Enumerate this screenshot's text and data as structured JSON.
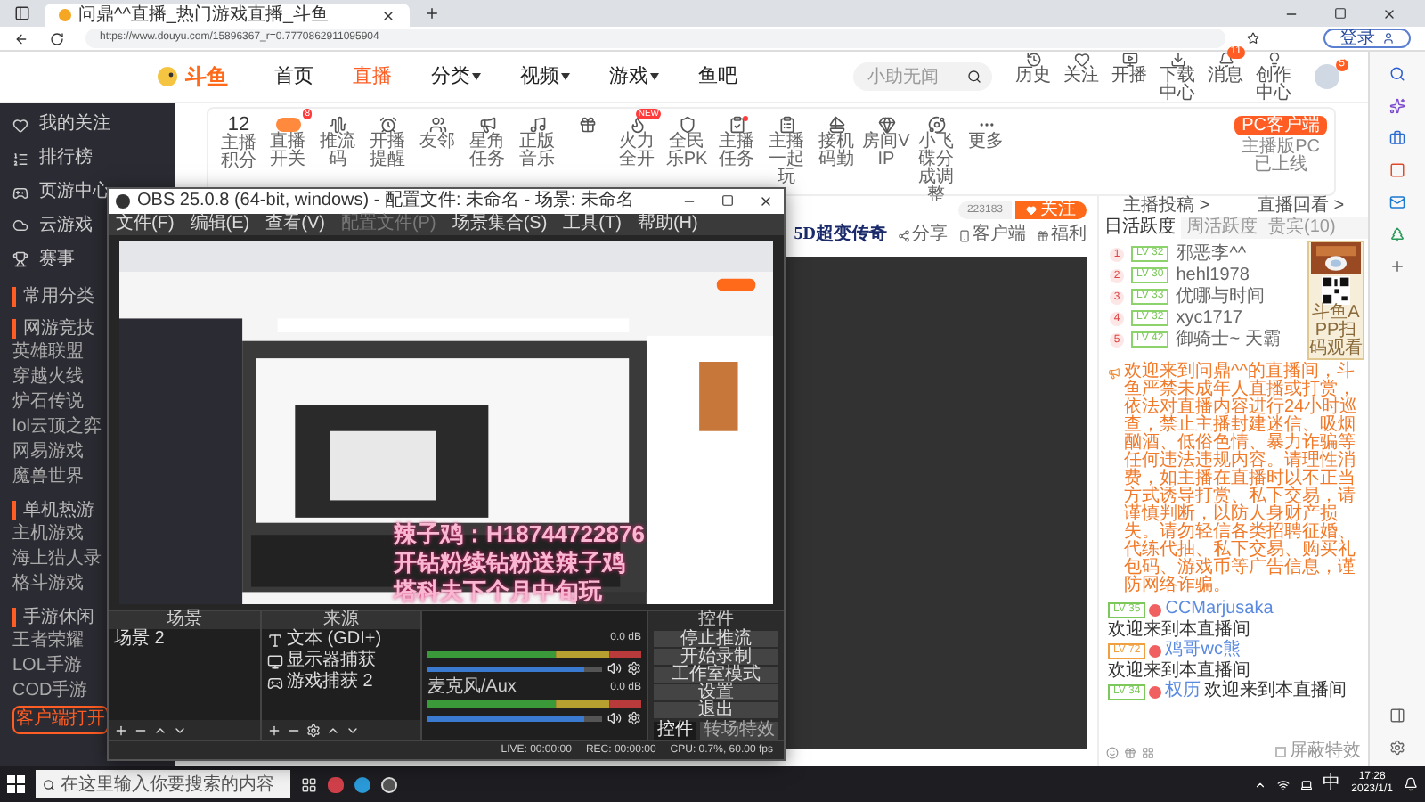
{
  "browser": {
    "tab_title": "问鼎^^直播_热门游戏直播_斗鱼",
    "url": "https://www.douyu.com/15896367_r=0.7770862911095904",
    "login": "登录"
  },
  "header": {
    "logo": "斗鱼",
    "nav": [
      {
        "label": "首页",
        "selected": false,
        "dropdown": false
      },
      {
        "label": "直播",
        "selected": true,
        "dropdown": false
      },
      {
        "label": "分类",
        "selected": false,
        "dropdown": true
      },
      {
        "label": "视频",
        "selected": false,
        "dropdown": true
      },
      {
        "label": "游戏",
        "selected": false,
        "dropdown": true
      },
      {
        "label": "鱼吧",
        "selected": false,
        "dropdown": false
      }
    ],
    "search": {
      "placeholder": "小助无闻"
    },
    "icons": [
      {
        "label": "历史"
      },
      {
        "label": "关注"
      },
      {
        "label": "开播"
      },
      {
        "label": "下载中心"
      },
      {
        "label": "消息",
        "badge": "11"
      },
      {
        "label": "创作中心"
      }
    ],
    "avatar_badge": "5"
  },
  "sidebar": {
    "items": [
      "我的关注",
      "排行榜",
      "页游中心",
      "云游戏",
      "赛事"
    ],
    "sections": [
      {
        "title": "常用分类"
      },
      {
        "title": "网游竞技",
        "items": [
          "英雄联盟",
          "穿越火线",
          "炉石传说",
          "lol云顶之弈",
          "网易游戏",
          "魔兽世界"
        ]
      },
      {
        "title": "单机热游",
        "items": [
          "主机游戏",
          "海上猎人录",
          "格斗游戏"
        ]
      },
      {
        "title": "手游休闲",
        "items": [
          "王者荣耀",
          "LOL手游",
          "COD手游"
        ]
      }
    ],
    "client_button": "客户端打开"
  },
  "toolbar": {
    "score": "12",
    "score_label": "主播积分",
    "items": [
      {
        "label": "直播开关",
        "badge": "8"
      },
      {
        "label": "推流码"
      },
      {
        "label": "开播提醒"
      },
      {
        "label": "友邻"
      },
      {
        "label": "星角任务"
      },
      {
        "label": "正版音乐"
      },
      {
        "label": "火力全开",
        "badge": "NEW"
      },
      {
        "label": "全民乐PK"
      },
      {
        "label": "主播任务",
        "dot": true
      },
      {
        "label": "主播一起玩"
      },
      {
        "label": "接机码勤"
      },
      {
        "label": "房间VIP"
      },
      {
        "label": "小飞碟分成调整"
      },
      {
        "label": "更多"
      }
    ],
    "pc_button": "PC客户端",
    "pc_note": "主播版PC已上线"
  },
  "room": {
    "followers": "223183",
    "follow": "关注",
    "logo": "5D超变传奇",
    "actions": [
      "分享",
      "客户端",
      "福利"
    ]
  },
  "chat": {
    "links": [
      "主播投稿 >",
      "直播回看 >"
    ],
    "tabs": [
      {
        "label": "日活跃度",
        "selected": true
      },
      {
        "label": "周活跃度",
        "selected": false
      },
      {
        "label": "贵宾(10)",
        "selected": false
      }
    ],
    "ranks": [
      {
        "rank": "1",
        "level": "LV 32",
        "name": "邪恶李^^"
      },
      {
        "rank": "2",
        "level": "LV 30",
        "name": "hehl1978"
      },
      {
        "rank": "3",
        "level": "LV 33",
        "name": "优哪与时间"
      },
      {
        "rank": "4",
        "level": "LV 32",
        "name": "xyc1717"
      },
      {
        "rank": "5",
        "level": "LV 42",
        "name": "御骑士~ 天霸"
      }
    ],
    "promo_caption": "斗鱼APP扫码观看",
    "notice": "欢迎来到问鼎^^的直播间，斗鱼严禁未成年人直播或打赏，依法对直播内容进行24小时巡查，禁止主播封建迷信、吸烟酗酒、低俗色情、暴力诈骗等任何违法违规内容。请理性消费，如主播在直播时以不正当方式诱导打赏、私下交易，请谨慎判断，以防人身财产损失。请勿轻信各类招聘征婚、代练代抽、私下交易、购买礼包码、游戏币等广告信息，谨防网络诈骗。",
    "messages": [
      {
        "level": "LV 35",
        "color": "#7cc85a",
        "name": "CCMarjusaka",
        "text": "欢迎来到本直播间"
      },
      {
        "level": "LV 72",
        "color": "#f0a040",
        "name": "鸡哥wc熊",
        "text": "欢迎来到本直播间"
      },
      {
        "level": "LV 34",
        "color": "#7cc85a",
        "name": "权历",
        "text": "欢迎来到本直播间"
      }
    ],
    "block_effects": {
      "label": "屏蔽特效",
      "checked": false
    }
  },
  "obs": {
    "title": "OBS 25.0.8 (64-bit, windows) - 配置文件: 未命名 - 场景: 未命名",
    "menu": [
      {
        "label": "文件(F)",
        "disabled": false
      },
      {
        "label": "编辑(E)",
        "disabled": false
      },
      {
        "label": "查看(V)",
        "disabled": false
      },
      {
        "label": "配置文件(P)",
        "disabled": true
      },
      {
        "label": "场景集合(S)",
        "disabled": false
      },
      {
        "label": "工具(T)",
        "disabled": false
      },
      {
        "label": "帮助(H)",
        "disabled": false
      }
    ],
    "overlay": [
      "辣子鸡：H18744722876",
      "开钻粉续钻粉送辣子鸡",
      "塔科夫下个月中旬玩"
    ],
    "scenes": {
      "title": "场景",
      "items": [
        "场景 2"
      ]
    },
    "sources": {
      "title": "来源",
      "items": [
        {
          "label": "文本 (GDI+)",
          "kind": "text"
        },
        {
          "label": "显示器捕获",
          "kind": "monitor"
        },
        {
          "label": "游戏捕获 2",
          "kind": "game"
        }
      ]
    },
    "channels": [
      {
        "reading": "0.0 dB",
        "level": 0.9
      },
      {
        "name": "麦克风/Aux",
        "reading": "0.0 dB",
        "level": 0.9
      }
    ],
    "controls": {
      "title": "控件",
      "buttons": [
        "停止推流",
        "开始录制",
        "工作室模式",
        "设置",
        "退出"
      ],
      "tabs": [
        {
          "label": "控件",
          "selected": true
        },
        {
          "label": "转场特效",
          "selected": false
        }
      ]
    },
    "status": {
      "live": "LIVE: 00:00:00",
      "rec": "REC: 00:00:00",
      "cpu": "CPU: 0.7%, 60.00 fps"
    }
  },
  "taskbar": {
    "search": {
      "placeholder": "在这里输入你要搜索的内容"
    },
    "ime": "中",
    "time": "17:28",
    "date": "2023/1/1"
  }
}
